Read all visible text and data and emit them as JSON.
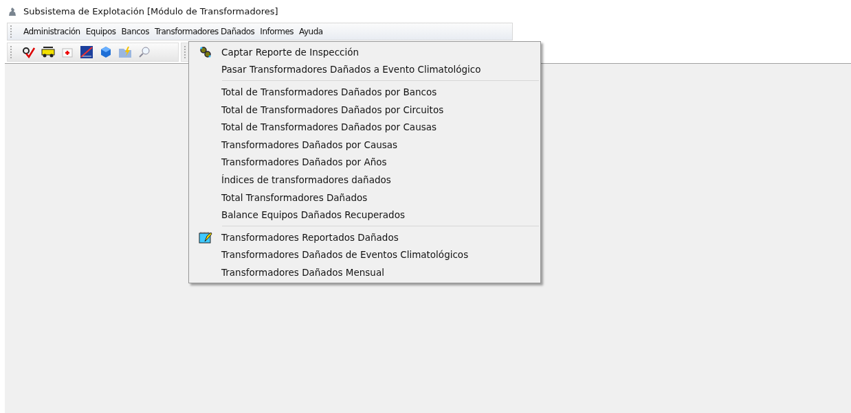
{
  "window": {
    "title": "Subsistema de Explotación [Módulo de Transformadores]"
  },
  "menu_bar": [
    {
      "label": "Administración"
    },
    {
      "label": "Equipos"
    },
    {
      "label": "Bancos"
    },
    {
      "label": "Transformadores Dañados"
    },
    {
      "label": "Informes"
    },
    {
      "label": "Ayuda"
    }
  ],
  "toolbar": [
    {
      "kind": "check"
    },
    {
      "kind": "truck"
    },
    {
      "kind": "firstaid"
    },
    {
      "kind": "chart"
    },
    {
      "kind": "cube"
    },
    {
      "kind": "folder"
    },
    {
      "kind": "search"
    }
  ],
  "dropdown": {
    "groups": [
      [
        {
          "label": "Captar Reporte de Inspección"
        },
        {
          "label": "Pasar Transformadores Dañados a Evento Climatológico"
        }
      ],
      [
        {
          "label": "Total de Transformadores Dañados por Bancos"
        },
        {
          "label": "Total de Transformadores Dañados por Circuitos"
        },
        {
          "label": "Total de Transformadores Dañados por Causas"
        },
        {
          "label": "Transformadores Dañados por Causas"
        },
        {
          "label": "Transformadores Dañados por Años"
        },
        {
          "label": "Índices de transformadores dañados"
        },
        {
          "label": "Total Transformadores Dañados"
        },
        {
          "label": "Balance Equipos Dañados Recuperados"
        }
      ],
      [
        {
          "label": "Transformadores Reportados Dañados"
        },
        {
          "label": "Transformadores Dañados de Eventos Climatológicos"
        },
        {
          "label": "Transformadores Dañados Mensual"
        }
      ]
    ]
  }
}
